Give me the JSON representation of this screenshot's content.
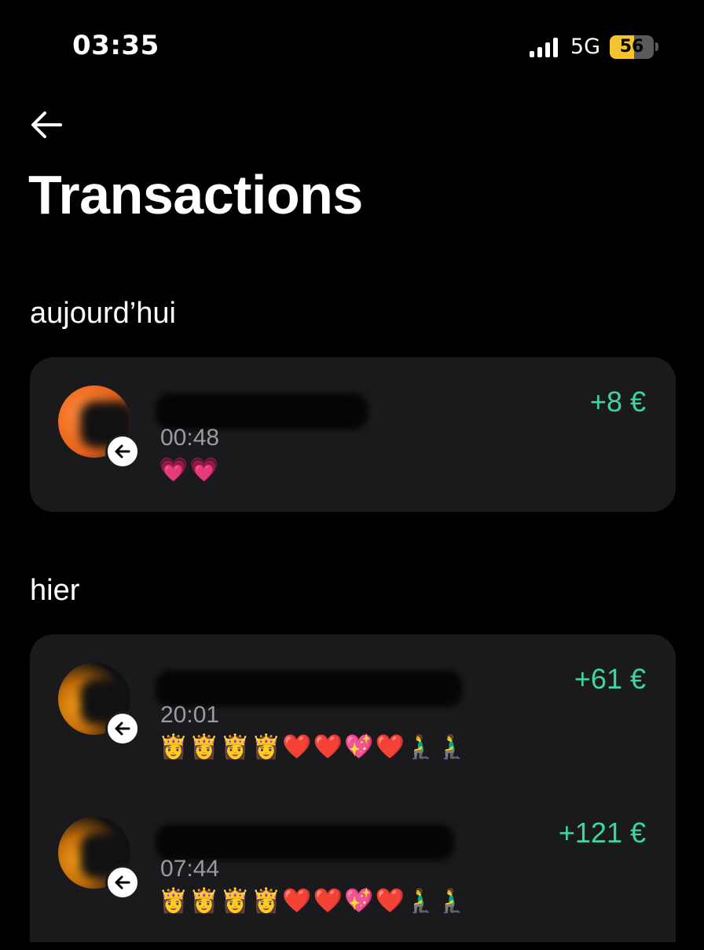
{
  "status_bar": {
    "time": "03:35",
    "network": "5G",
    "battery_level": "56",
    "battery_percent": 56,
    "battery_color": "#f4c430"
  },
  "header": {
    "back_icon": "arrow-left-icon",
    "title": "Transactions"
  },
  "sections": [
    {
      "heading": "aujourd’hui",
      "transactions": [
        {
          "time": "00:48",
          "note": "💗💗",
          "amount": "+8 €",
          "direction_icon": "arrow-left-icon"
        }
      ]
    },
    {
      "heading": "hier",
      "transactions": [
        {
          "time": "20:01",
          "note": "👸👸👸👸❤️❤️💖❤️🧎‍♂️🧎‍♂️",
          "amount": "+61 €",
          "direction_icon": "arrow-left-icon"
        },
        {
          "time": "07:44",
          "note": "👸👸👸👸❤️❤️💖❤️🧎‍♂️🧎‍♂️",
          "amount": "+121 €",
          "direction_icon": "arrow-left-icon"
        }
      ]
    }
  ],
  "colors": {
    "background": "#000000",
    "card": "#1a1a1c",
    "amount_positive": "#3dd6a0",
    "secondary_text": "#9a9aa0"
  }
}
